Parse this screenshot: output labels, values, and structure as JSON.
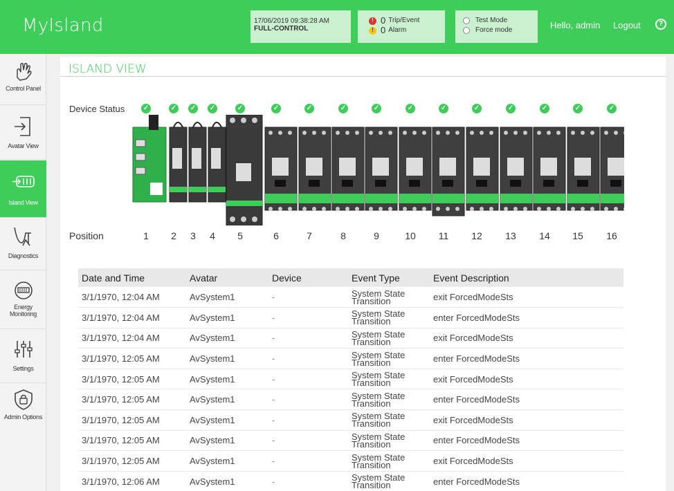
{
  "app": {
    "brand": "MyIsland"
  },
  "header": {
    "datetime": "17/06/2019 09:38:28 AM",
    "control_mode": "FULL-CONTROL",
    "trip_count": "0",
    "trip_label": "Trip/Event",
    "alarm_count": "0",
    "alarm_label": "Alarm",
    "test_mode_label": "Test Mode",
    "force_mode_label": "Force mode",
    "greeting": "Hello, admin",
    "logout_label": "Logout",
    "help_glyph": "?"
  },
  "sidebar": {
    "items": [
      {
        "label": "Control Panel",
        "icon": "hand-icon"
      },
      {
        "label": "Avatar View",
        "icon": "enter-icon"
      },
      {
        "label": "Island View",
        "icon": "island-icon",
        "active": true
      },
      {
        "label": "Diagnostics",
        "icon": "stethoscope-icon"
      },
      {
        "label": "Energy Monitoring",
        "icon": "meter-icon"
      },
      {
        "label": "Settings",
        "icon": "sliders-icon"
      },
      {
        "label": "Admin Options",
        "icon": "shield-lock-icon"
      }
    ]
  },
  "island": {
    "title": "ISLAND VIEW",
    "device_status_label": "Device Status",
    "position_label": "Position",
    "positions": [
      "1",
      "2",
      "3",
      "4",
      "5",
      "6",
      "7",
      "8",
      "9",
      "10",
      "11",
      "12",
      "13",
      "14",
      "15",
      "16"
    ],
    "status_glyph": "✓"
  },
  "events": {
    "columns": [
      "Date and Time",
      "Avatar",
      "Device",
      "Event Type",
      "Event Description"
    ],
    "rows": [
      [
        "3/1/1970, 12:04 AM",
        "AvSystem1",
        "-",
        "System State Transition",
        "exit ForcedModeSts"
      ],
      [
        "3/1/1970, 12:04 AM",
        "AvSystem1",
        "-",
        "System State Transition",
        "enter ForcedModeSts"
      ],
      [
        "3/1/1970, 12:04 AM",
        "AvSystem1",
        "-",
        "System State Transition",
        "exit ForcedModeSts"
      ],
      [
        "3/1/1970, 12:05 AM",
        "AvSystem1",
        "-",
        "System State Transition",
        "enter ForcedModeSts"
      ],
      [
        "3/1/1970, 12:05 AM",
        "AvSystem1",
        "-",
        "System State Transition",
        "exit ForcedModeSts"
      ],
      [
        "3/1/1970, 12:05 AM",
        "AvSystem1",
        "-",
        "System State Transition",
        "enter ForcedModeSts"
      ],
      [
        "3/1/1970, 12:05 AM",
        "AvSystem1",
        "-",
        "System State Transition",
        "exit ForcedModeSts"
      ],
      [
        "3/1/1970, 12:05 AM",
        "AvSystem1",
        "-",
        "System State Transition",
        "enter ForcedModeSts"
      ],
      [
        "3/1/1970, 12:05 AM",
        "AvSystem1",
        "-",
        "System State Transition",
        "exit ForcedModeSts"
      ],
      [
        "3/1/1970, 12:06 AM",
        "AvSystem1",
        "-",
        "System State Transition",
        "enter ForcedModeSts"
      ]
    ]
  },
  "colors": {
    "brand_green": "#3dcd58",
    "header_box": "#c9f0cf",
    "trip_red": "#e3302f",
    "alarm_yellow": "#f6c411"
  }
}
